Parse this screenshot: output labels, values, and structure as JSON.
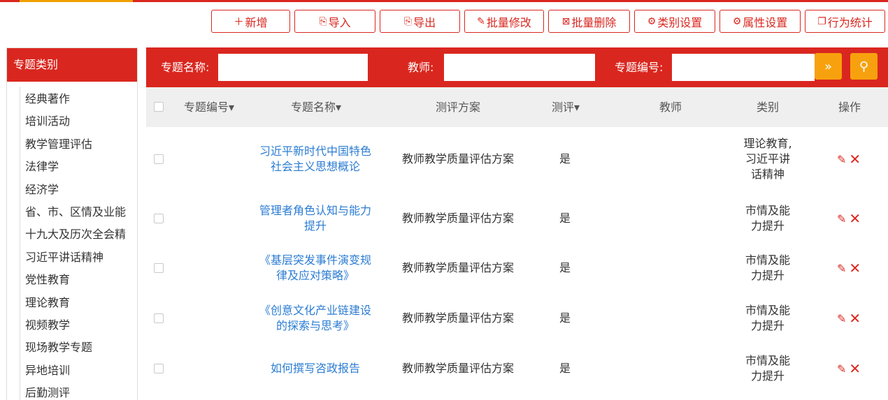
{
  "colors": {
    "primary": "#d9271f",
    "accent": "#f8a10e",
    "link": "#2b7cd3"
  },
  "toolbar": [
    {
      "icon": "plus-icon",
      "glyph": "＋",
      "label": "新增"
    },
    {
      "icon": "import-icon",
      "glyph": "⎘",
      "label": "导入"
    },
    {
      "icon": "export-icon",
      "glyph": "⎘",
      "label": "导出"
    },
    {
      "icon": "edit-icon",
      "glyph": "✎",
      "label": "批量修改"
    },
    {
      "icon": "delete-box-icon",
      "glyph": "⊠",
      "label": "批量删除"
    },
    {
      "icon": "gear-icon",
      "glyph": "⚙",
      "label": "类别设置"
    },
    {
      "icon": "gear-icon",
      "glyph": "⚙",
      "label": "属性设置"
    },
    {
      "icon": "copy-icon",
      "glyph": "❐",
      "label": "行为统计"
    }
  ],
  "sidebar": {
    "title": "专题类别",
    "items": [
      "经典著作",
      "培训活动",
      "教学管理评估",
      "法律学",
      "经济学",
      "省、市、区情及业能",
      "十九大及历次全会精",
      "习近平讲话精神",
      "党性教育",
      "理论教育",
      "视频教学",
      "现场教学专题",
      "异地培训",
      "后勤测评"
    ]
  },
  "search": {
    "name_label": "专题名称:",
    "teacher_label": "教师:",
    "code_label": "专题编号:",
    "name_value": "",
    "teacher_value": "",
    "code_value": ""
  },
  "table": {
    "headers": {
      "code": "专题编号▾",
      "name": "专题名称▾",
      "plan": "测评方案",
      "eval": "测评▾",
      "teacher": "教师",
      "category": "类别",
      "ops": "操作"
    },
    "rows": [
      {
        "name_l1": "习近平新时代中国特色",
        "name_l2": "社会主义思想概论",
        "plan": "教师教学质量评估方案",
        "eval": "是",
        "cat_l1": "理论教育,",
        "cat_l2": "习近平讲",
        "cat_l3": "话精神"
      },
      {
        "name_l1": "管理者角色认知与能力",
        "name_l2": "提升",
        "plan": "教师教学质量评估方案",
        "eval": "是",
        "cat_l1": "市情及能",
        "cat_l2": "力提升",
        "cat_l3": ""
      },
      {
        "name_l1": "《基层突发事件演变规",
        "name_l2": "律及应对策略》",
        "plan": "教师教学质量评估方案",
        "eval": "是",
        "cat_l1": "市情及能",
        "cat_l2": "力提升",
        "cat_l3": ""
      },
      {
        "name_l1": "《创意文化产业链建设",
        "name_l2": "的探索与思考》",
        "plan": "教师教学质量评估方案",
        "eval": "是",
        "cat_l1": "市情及能",
        "cat_l2": "力提升",
        "cat_l3": ""
      },
      {
        "name_l1": "如何撰写咨政报告",
        "name_l2": "",
        "plan": "教师教学质量评估方案",
        "eval": "是",
        "cat_l1": "市情及能",
        "cat_l2": "力提升",
        "cat_l3": ""
      }
    ]
  }
}
